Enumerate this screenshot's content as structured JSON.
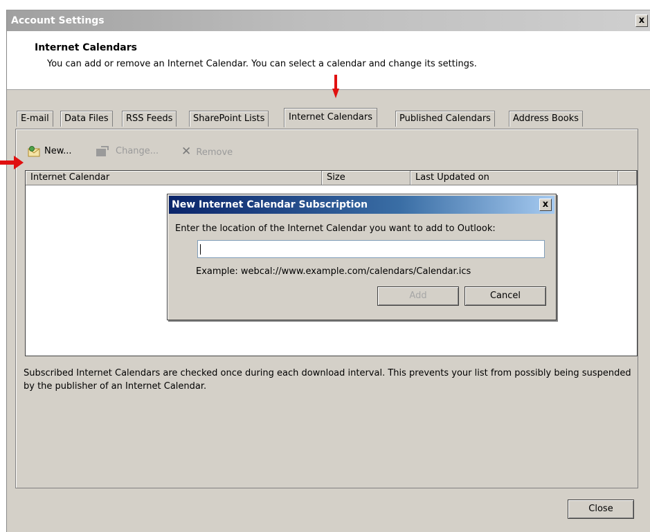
{
  "window": {
    "title": "Account Settings",
    "close_label": "x"
  },
  "header": {
    "title": "Internet Calendars",
    "subtitle": "You can add or remove an Internet Calendar. You can select a calendar and change its settings."
  },
  "tabs": [
    {
      "label": "E-mail"
    },
    {
      "label": "Data Files"
    },
    {
      "label": "RSS Feeds"
    },
    {
      "label": "SharePoint Lists"
    },
    {
      "label": "Internet Calendars"
    },
    {
      "label": "Published Calendars"
    },
    {
      "label": "Address Books"
    }
  ],
  "toolbar": {
    "new_label": "New...",
    "change_label": "Change...",
    "remove_label": "Remove"
  },
  "list": {
    "columns": [
      "Internet Calendar",
      "Size",
      "Last Updated on"
    ]
  },
  "info_text": "Subscribed Internet Calendars are checked once during each download interval. This prevents your list from possibly being suspended by the publisher of an Internet Calendar.",
  "close_button": "Close",
  "dialog": {
    "title": "New Internet Calendar Subscription",
    "close_label": "x",
    "prompt": "Enter the location of the Internet Calendar you want to add to Outlook:",
    "input_value": "",
    "example": "Example: webcal://www.example.com/calendars/Calendar.ics",
    "add_label": "Add",
    "cancel_label": "Cancel"
  },
  "annotation_color": "#e01010"
}
